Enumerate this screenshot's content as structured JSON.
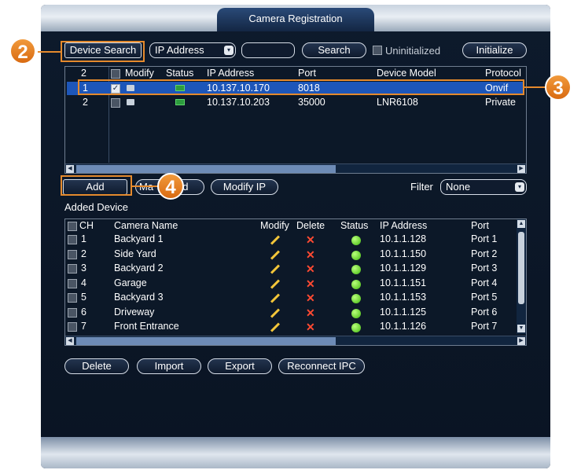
{
  "window": {
    "title": "Camera Registration"
  },
  "search_bar": {
    "device_search_label": "Device Search",
    "search_type_value": "IP Address",
    "search_input_value": "",
    "search_button_label": "Search",
    "uninitialized_label": "Uninitialized",
    "initialize_button_label": "Initialize"
  },
  "device_table": {
    "headers": {
      "count": "2",
      "modify": "Modify",
      "status": "Status",
      "ip": "IP Address",
      "port": "Port",
      "model": "Device Model",
      "protocol": "Protocol"
    },
    "rows": [
      {
        "num": "1",
        "ip": "10.137.10.170",
        "port": "8018",
        "model": "",
        "protocol": "Onvif"
      },
      {
        "num": "2",
        "ip": "10.137.10.203",
        "port": "35000",
        "model": "LNR6108",
        "protocol": "Private"
      }
    ]
  },
  "add_bar": {
    "add_button_label": "Add",
    "manual_add_label_left": "Ma",
    "manual_add_label_right": "dd",
    "modify_ip_label": "Modify IP",
    "filter_label": "Filter",
    "filter_value": "None"
  },
  "added_device": {
    "section_label": "Added Device",
    "headers": {
      "ch": "CH",
      "name": "Camera Name",
      "modify": "Modify",
      "delete": "Delete",
      "status": "Status",
      "ip": "IP Address",
      "port": "Port"
    },
    "rows": [
      {
        "ch": "1",
        "name": "Backyard 1",
        "ip": "10.1.1.128",
        "port": "Port 1"
      },
      {
        "ch": "2",
        "name": "Side Yard",
        "ip": "10.1.1.150",
        "port": "Port 2"
      },
      {
        "ch": "3",
        "name": "Backyard 2",
        "ip": "10.1.1.129",
        "port": "Port 3"
      },
      {
        "ch": "4",
        "name": "Garage",
        "ip": "10.1.1.151",
        "port": "Port 4"
      },
      {
        "ch": "5",
        "name": "Backyard 3",
        "ip": "10.1.1.153",
        "port": "Port 5"
      },
      {
        "ch": "6",
        "name": "Driveway",
        "ip": "10.1.1.125",
        "port": "Port 6"
      },
      {
        "ch": "7",
        "name": "Front Entrance",
        "ip": "10.1.1.126",
        "port": "Port 7"
      }
    ]
  },
  "bottom_buttons": {
    "delete": "Delete",
    "import": "Import",
    "export": "Export",
    "reconnect": "Reconnect IPC"
  },
  "callouts": {
    "badge_2": "2",
    "badge_3": "3",
    "badge_4": "4"
  },
  "colors": {
    "accent_orange": "#e58a2d",
    "selection_blue": "#1d56b9",
    "status_green": "#42b80f",
    "delete_red": "#ff4a32"
  }
}
